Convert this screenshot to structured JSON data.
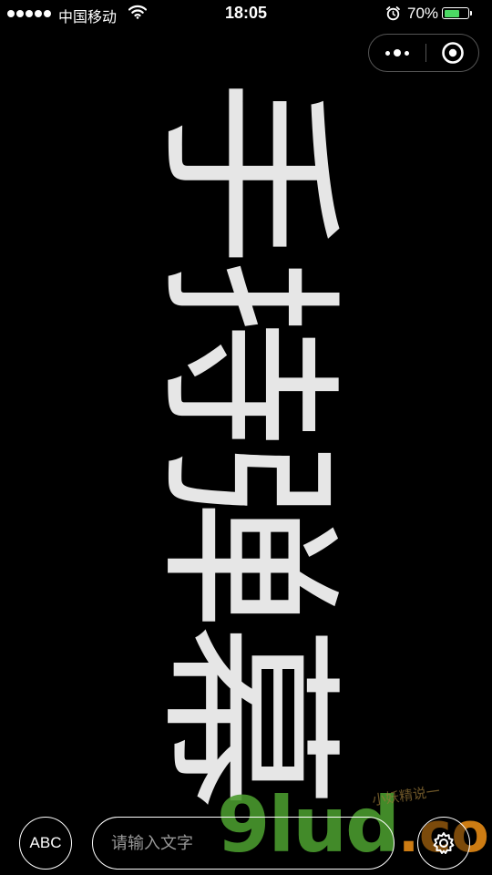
{
  "status_bar": {
    "carrier": "中国移动",
    "time": "18:05",
    "battery_percent": "70%",
    "battery_level": 0.7,
    "icons": [
      "signal-dots-icon",
      "wifi-icon",
      "alarm-icon",
      "battery-icon"
    ]
  },
  "capsule": {
    "more_icon": "more-dots-icon",
    "close_icon": "target-circle-icon"
  },
  "banner": {
    "text": "手持弹幕",
    "color": "#e6e6e6",
    "background": "#000000",
    "orientation": "vertical-rotated"
  },
  "controls": {
    "style_button_label": "ABC",
    "input_placeholder": "请输入文字",
    "settings_icon": "gear-icon"
  },
  "watermark": {
    "main": "9lud",
    "suffix": ".com",
    "small_text": "小妖精说一"
  },
  "colors": {
    "battery_fill": "#4cd964",
    "watermark_green": "#4a9a2e",
    "watermark_orange": "#e48a16"
  }
}
